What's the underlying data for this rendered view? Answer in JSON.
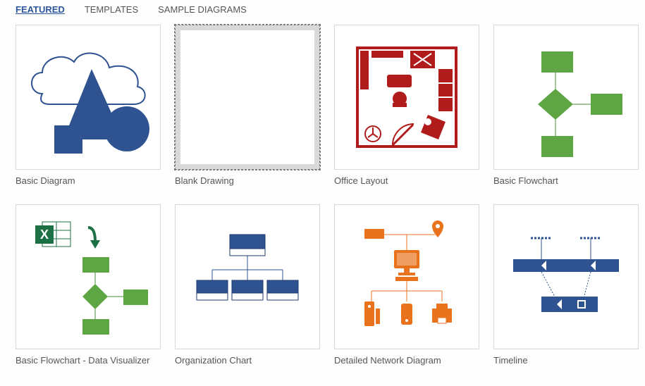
{
  "tabs": {
    "featured": "FEATURED",
    "templates": "TEMPLATES",
    "sample": "SAMPLE DIAGRAMS"
  },
  "templates": {
    "basic_diagram": "Basic Diagram",
    "blank_drawing": "Blank Drawing",
    "office_layout": "Office Layout",
    "basic_flowchart": "Basic Flowchart",
    "flowchart_visualizer": "Basic Flowchart - Data Visualizer",
    "org_chart": "Organization Chart",
    "network_diagram": "Detailed Network Diagram",
    "timeline": "Timeline"
  }
}
